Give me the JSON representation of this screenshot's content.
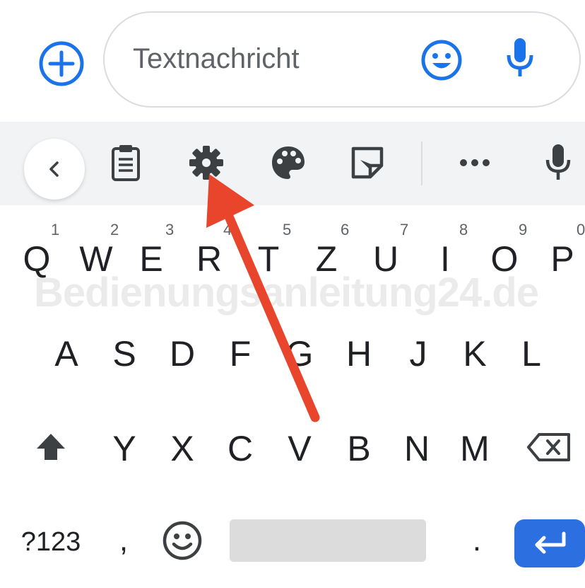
{
  "compose": {
    "placeholder": "Textnachricht"
  },
  "toolbar": {
    "items": [
      "back",
      "clipboard",
      "settings",
      "theme",
      "sticker",
      "more",
      "voice"
    ]
  },
  "keyboard": {
    "row1": [
      {
        "key": "Q",
        "hint": "1"
      },
      {
        "key": "W",
        "hint": "2"
      },
      {
        "key": "E",
        "hint": "3"
      },
      {
        "key": "R",
        "hint": "4"
      },
      {
        "key": "T",
        "hint": "5"
      },
      {
        "key": "Z",
        "hint": "6"
      },
      {
        "key": "U",
        "hint": "7"
      },
      {
        "key": "I",
        "hint": "8"
      },
      {
        "key": "O",
        "hint": "9"
      },
      {
        "key": "P",
        "hint": "0"
      }
    ],
    "row2": [
      "A",
      "S",
      "D",
      "F",
      "G",
      "H",
      "J",
      "K",
      "L"
    ],
    "row3": [
      "Y",
      "X",
      "C",
      "V",
      "B",
      "N",
      "M"
    ],
    "symbols_label": "?123",
    "comma": ",",
    "period": "."
  },
  "watermark": "Bedienungsanleitung24.de",
  "colors": {
    "accent": "#2c6fe0",
    "annotation_arrow": "#e8452c"
  }
}
